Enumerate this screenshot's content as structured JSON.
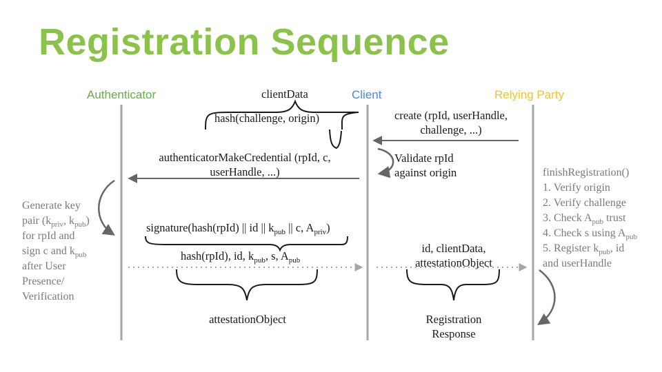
{
  "title": "Registration Sequence",
  "actors": {
    "authenticator": {
      "label": "Authenticator",
      "color": "#6aa84f"
    },
    "client": {
      "label": "Client",
      "color": "#4a86e8"
    },
    "relying_party": {
      "label": "Relying Party",
      "color": "#f1c232"
    }
  },
  "messages": {
    "client_data_label": "clientData",
    "hash_challenge": "hash(challenge, origin)",
    "create_line1": "create (rpId, userHandle,",
    "create_line2": "challenge, ...)",
    "make_cred_line1": "authenticatorMakeCredential (rpId, c,",
    "make_cred_line2": "userHandle, ...)",
    "validate_line1": "Validate rpId",
    "validate_line2": "against origin",
    "signature_pre": "signature(hash(rpId) || id || k",
    "signature_sub1": "pub",
    "signature_mid": " || c, A",
    "signature_sub2": "priv",
    "signature_post": ")",
    "hash_pre": "hash(rpId), id, k",
    "hash_sub1": "pub",
    "hash_mid": ", s, A",
    "hash_sub2": "pub",
    "attestation_object": "attestationObject",
    "client_response_line1": "id, clientData,",
    "client_response_line2": "attestationObject",
    "registration_response_line1": "Registration",
    "registration_response_line2": "Response"
  },
  "authenticator_note": {
    "l1": "Generate key",
    "l2_pre": "pair (k",
    "l2_sub1": "priv",
    "l2_mid": ", k",
    "l2_sub2": "pub",
    "l2_post": ")",
    "l3": "for rpId and",
    "l4_pre": "sign c and k",
    "l4_sub": "pub",
    "l5": "after User",
    "l6": "Presence/",
    "l7": "Verification"
  },
  "rp_steps": {
    "header": "finishRegistration()",
    "s1": "1. Verify origin",
    "s2": "2. Verify challenge",
    "s3_pre": "3. Check A",
    "s3_sub": "pub",
    "s3_post": " trust",
    "s4_pre": "4. Check s using A",
    "s4_sub": "pub",
    "s5_pre": "5. Register k",
    "s5_sub": "pub",
    "s5_post": ", id",
    "s6": "and userHandle"
  },
  "colors": {
    "title": "#8bc34a",
    "lifeline": "#a6a6a6",
    "arrow": "#666666",
    "note_text": "#7a7a7a"
  }
}
